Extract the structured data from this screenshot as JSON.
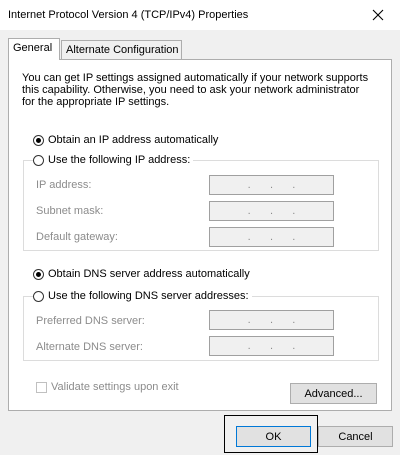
{
  "window": {
    "title": "Internet Protocol Version 4 (TCP/IPv4) Properties",
    "close_icon": "close-icon"
  },
  "tabs": [
    {
      "label": "General",
      "active": true
    },
    {
      "label": "Alternate Configuration",
      "active": false
    }
  ],
  "general": {
    "description": "You can get IP settings assigned automatically if your network supports this capability. Otherwise, you need to ask your network administrator for the appropriate IP settings.",
    "ip": {
      "auto_label": "Obtain an IP address automatically",
      "manual_label": "Use the following IP address:",
      "selected": "auto",
      "fields": [
        {
          "label": "IP address:",
          "value": ". . ."
        },
        {
          "label": "Subnet mask:",
          "value": ". . ."
        },
        {
          "label": "Default gateway:",
          "value": ". . ."
        }
      ]
    },
    "dns": {
      "auto_label": "Obtain DNS server address automatically",
      "manual_label": "Use the following DNS server addresses:",
      "selected": "auto",
      "fields": [
        {
          "label": "Preferred DNS server:",
          "value": ". . ."
        },
        {
          "label": "Alternate DNS server:",
          "value": ". . ."
        }
      ]
    },
    "validate_label": "Validate settings upon exit",
    "advanced_label": "Advanced..."
  },
  "footer": {
    "ok_label": "OK",
    "cancel_label": "Cancel"
  }
}
